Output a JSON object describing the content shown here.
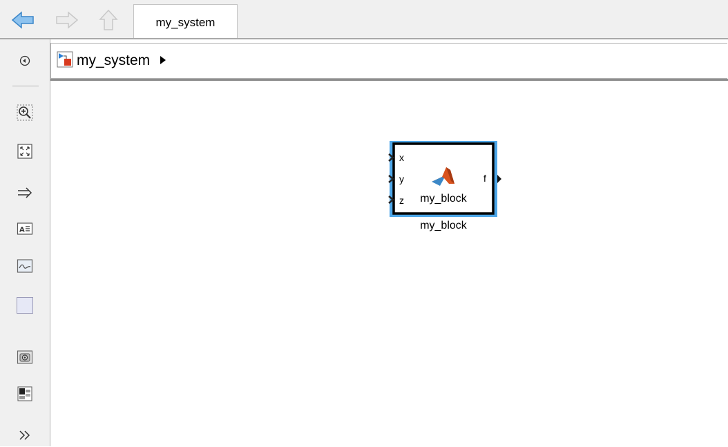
{
  "window": {
    "tab_title": "my_system"
  },
  "nav": {
    "back": "back-arrow",
    "forward": "forward-arrow",
    "up": "up-arrow"
  },
  "breadcrumb": {
    "model_name": "my_system"
  },
  "toolbar": {
    "items": [
      "hide-browser-icon",
      "zoom-icon",
      "fit-to-view-icon",
      "signal-routing-icon",
      "annotation-icon",
      "image-icon",
      "area-icon",
      "screenshot-icon",
      "model-data-icon",
      "more-icon"
    ]
  },
  "block": {
    "name": "my_block",
    "inner_label": "my_block",
    "inputs": [
      "x",
      "y",
      "z"
    ],
    "outputs": [
      "f"
    ],
    "icon": "matlab-logo-icon",
    "selection_color": "#4da6e8"
  },
  "colors": {
    "accent_blue": "#4da6e8",
    "toolbar_bg": "#f0f0f0"
  }
}
